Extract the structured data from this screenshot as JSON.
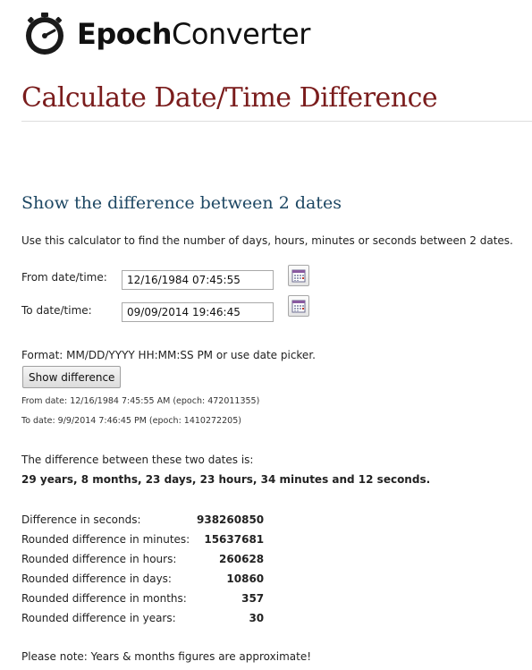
{
  "header": {
    "logo_bold": "Epoch",
    "logo_light": "Converter"
  },
  "page_title": "Calculate Date/Time Difference",
  "section_title": "Show the difference between 2 dates",
  "intro": "Use this calculator to find the number of days, hours, minutes or seconds between 2 dates.",
  "form": {
    "from_label": "From date/time:",
    "from_value": "12/16/1984 07:45:55",
    "to_label": "To date/time:",
    "to_value": "09/09/2014 19:46:45",
    "format_note": "Format: MM/DD/YYYY HH:MM:SS PM or use date picker.",
    "button_label": "Show difference"
  },
  "result": {
    "from_line": "From date: 12/16/1984 7:45:55 AM (epoch: 472011355)",
    "to_line": "To date: 9/9/2014 7:46:45 PM (epoch: 1410272205)",
    "intro": "The difference between these two dates is:",
    "summary": "29 years, 8 months, 23 days, 23 hours, 34 minutes and 12 seconds.",
    "rows": [
      {
        "label": "Difference in seconds:",
        "value": "938260850"
      },
      {
        "label": "Rounded difference in minutes:",
        "value": "15637681"
      },
      {
        "label": "Rounded difference in hours:",
        "value": "260628"
      },
      {
        "label": "Rounded difference in days:",
        "value": "10860"
      },
      {
        "label": "Rounded difference in months:",
        "value": "357"
      },
      {
        "label": "Rounded difference in years:",
        "value": "30"
      }
    ],
    "note": "Please note: Years & months figures are approximate!"
  },
  "icons": {
    "logo": "clock-icon",
    "date_picker": "calendar-icon"
  },
  "colors": {
    "page_title": "#7a1c1c",
    "section_title": "#1d4763"
  }
}
